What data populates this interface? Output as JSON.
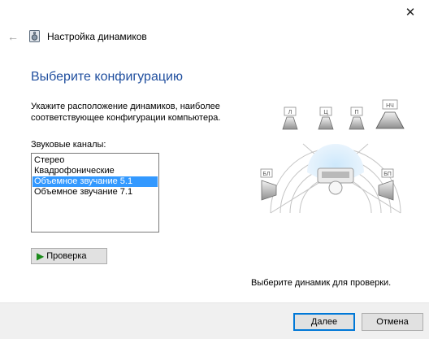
{
  "window": {
    "title": "Настройка динамиков",
    "close_glyph": "✕",
    "back_glyph": "←"
  },
  "page": {
    "heading": "Выберите конфигурацию",
    "description": "Укажите расположение динамиков, наиболее соответствующее конфигурации компьютера.",
    "channels_label": "Звуковые каналы:",
    "channels": [
      "Стерео",
      "Квадрофонические",
      "Объемное звучание 5.1",
      "Объемное звучание 7.1"
    ],
    "selected_channel": "Объемное звучание 5.1",
    "test_button": "Проверка",
    "hint": "Выберите динамик для проверки."
  },
  "diagram": {
    "speakers": {
      "front_left": "Л",
      "center": "Ц",
      "front_right": "П",
      "subwoofer": "НЧ",
      "rear_left": "БЛ",
      "rear_right": "БП"
    }
  },
  "footer": {
    "next": "Далее",
    "cancel": "Отмена"
  },
  "colors": {
    "heading": "#1f4e9e",
    "selection": "#3399ff",
    "play": "#1a8a1a",
    "footer_bg": "#f0f0f0",
    "default_button_border": "#0078d7"
  }
}
